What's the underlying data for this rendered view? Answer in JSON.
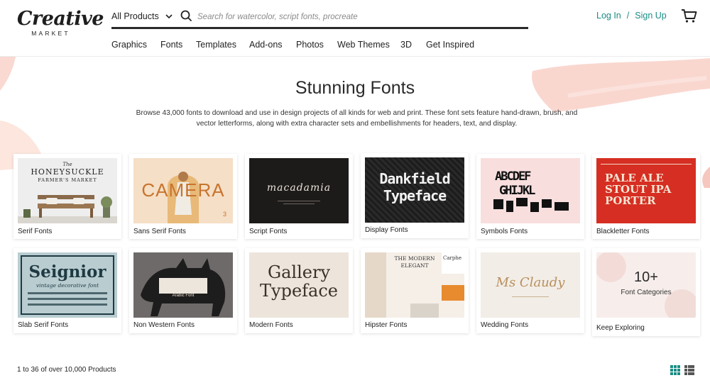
{
  "brand": {
    "logo_main": "Creative",
    "logo_sub": "MARKET",
    "accent_color": "#1a8c84"
  },
  "search": {
    "category": "All Products",
    "placeholder": "Search for watercolor, script fonts, procreate"
  },
  "auth": {
    "login": "Log In",
    "separator": "/",
    "signup": "Sign Up"
  },
  "nav": {
    "items": [
      "Graphics",
      "Fonts",
      "Templates",
      "Add-ons",
      "Photos",
      "Web Themes",
      "3D",
      "Get Inspired"
    ]
  },
  "hero": {
    "title": "Stunning Fonts",
    "description": "Browse 43,000 fonts to download and use in design projects of all kinds for web and print. These font sets feature hand-drawn, brush, and vector letterforms, along with extra character sets and embellishments for headers, text, and display."
  },
  "categories": [
    {
      "label": "Serif Fonts",
      "thumb": {
        "line1": "The",
        "line2": "HONEYSUCKLE",
        "line3": "FARMER'S MARKET"
      }
    },
    {
      "label": "Sans Serif Fonts",
      "thumb": {
        "line1": "CAMERA"
      }
    },
    {
      "label": "Script Fonts",
      "thumb": {
        "line1": "macadamia"
      }
    },
    {
      "label": "Display Fonts",
      "thumb": {
        "line1": "Dankfield",
        "line2": "Typeface"
      }
    },
    {
      "label": "Symbols Fonts",
      "thumb": {
        "line1": "ABCDEF",
        "line2": "GHIJKL"
      }
    },
    {
      "label": "Blackletter Fonts",
      "thumb": {
        "line1": "PALE ALE",
        "line2": "STOUT IPA",
        "line3": "PORTER"
      }
    },
    {
      "label": "Slab Serif Fonts",
      "thumb": {
        "line1": "Seignior",
        "line2": "vintage decorative font"
      }
    },
    {
      "label": "Non Western Fonts",
      "thumb": {
        "line1": "Arabic Font"
      }
    },
    {
      "label": "Modern Fonts",
      "thumb": {
        "line1": "Gallery",
        "line2": "Typeface"
      }
    },
    {
      "label": "Hipster Fonts",
      "thumb": {
        "line1": "THE MODERN",
        "line2": "ELEGANT",
        "line3": "Carphe"
      }
    },
    {
      "label": "Wedding Fonts",
      "thumb": {
        "line1": "Ms Claudy"
      }
    },
    {
      "label": "Keep Exploring",
      "thumb": {
        "line1": "10+",
        "line2": "Font Categories"
      }
    }
  ],
  "results": {
    "count_text": "1 to 36 of over 10,000 Products"
  },
  "views": [
    "grid-view-icon",
    "list-view-icon"
  ]
}
